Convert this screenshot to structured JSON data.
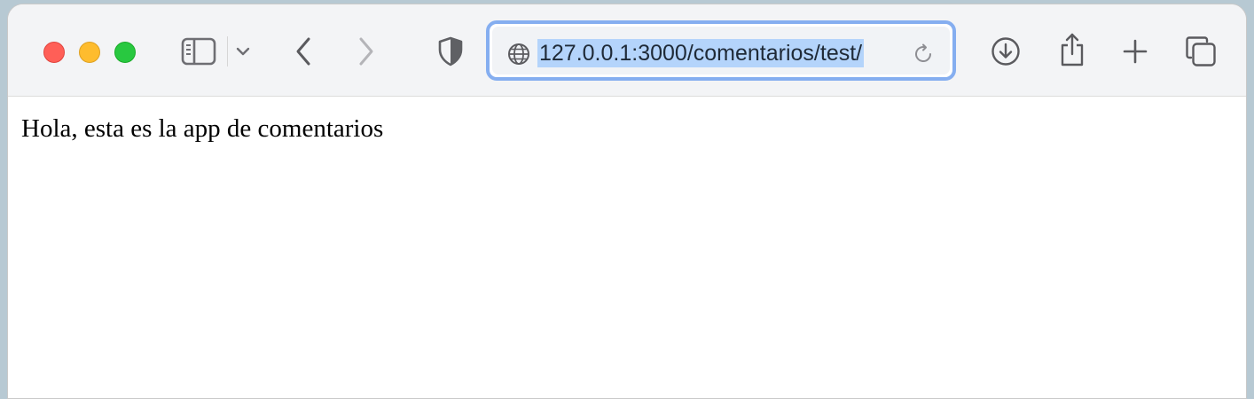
{
  "browser": {
    "address_bar": {
      "url": "127.0.0.1:3000/comentarios/test/"
    }
  },
  "page": {
    "body_text": "Hola, esta es la app de comentarios"
  },
  "icons": {
    "sidebar": "sidebar-icon",
    "tab_group_menu": "chevron-down-icon",
    "back": "chevron-left-icon",
    "forward": "chevron-right-icon",
    "privacy": "shield-icon",
    "site": "globe-icon",
    "reload": "reload-icon",
    "downloads": "download-icon",
    "share": "share-icon",
    "new_tab": "plus-icon",
    "tab_overview": "tabs-overview-icon"
  },
  "colors": {
    "close": "#ff5f57",
    "minimize": "#febc2e",
    "zoom": "#28c840",
    "focus_ring": "#85aef0",
    "url_selection": "#b4d4fb"
  }
}
